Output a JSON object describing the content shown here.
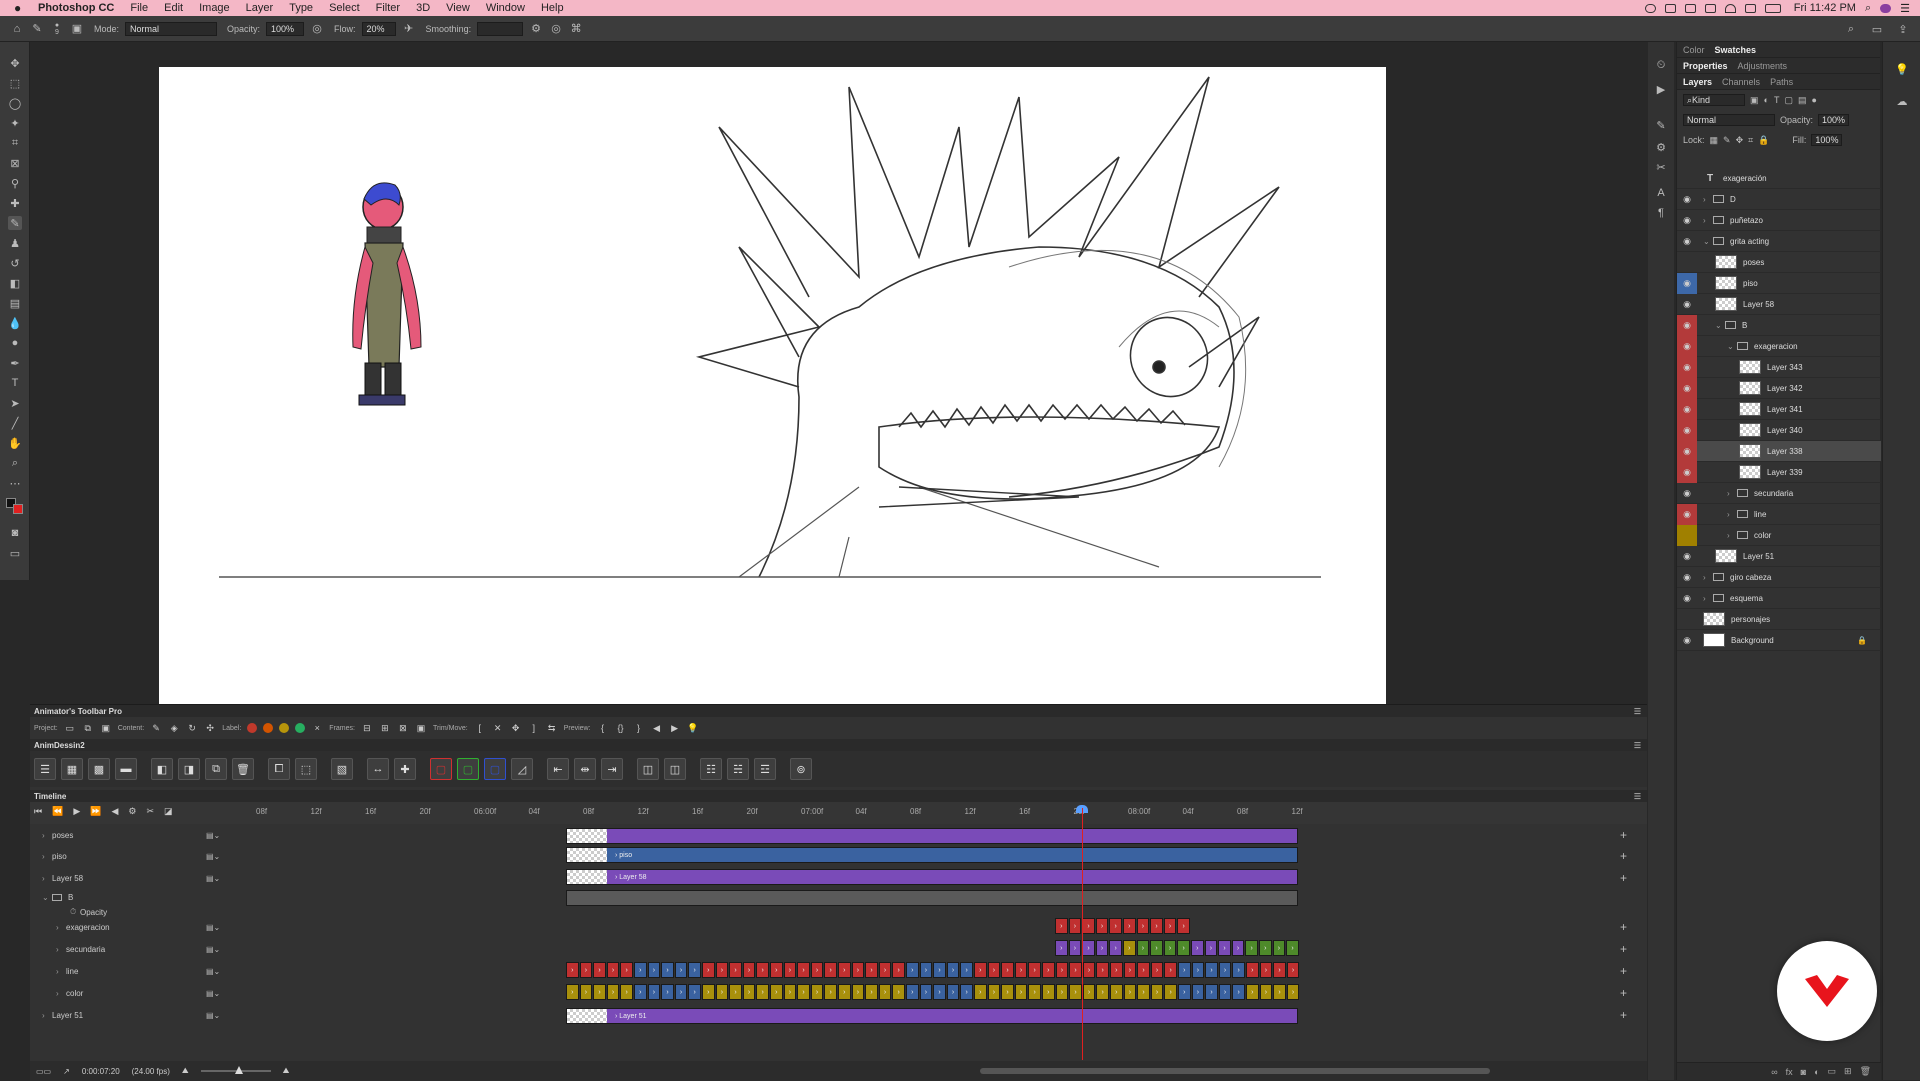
{
  "menubar": {
    "app_name": "Photoshop CC",
    "menus": [
      "File",
      "Edit",
      "Image",
      "Layer",
      "Type",
      "Select",
      "Filter",
      "3D",
      "View",
      "Window",
      "Help"
    ],
    "clock": "Fri 11:42 PM"
  },
  "options_bar": {
    "brush_size": "9",
    "mode_label": "Mode:",
    "mode_value": "Normal",
    "opacity_label": "Opacity:",
    "opacity_value": "100%",
    "flow_label": "Flow:",
    "flow_value": "20%",
    "smoothing_label": "Smoothing:"
  },
  "panels": {
    "top_tabs": [
      "Color",
      "Swatches"
    ],
    "mid_tabs": [
      "Properties",
      "Adjustments"
    ],
    "layer_tabs": [
      "Layers",
      "Channels",
      "Paths"
    ],
    "filter_kind": "Kind",
    "blend_mode": "Normal",
    "opacity_label": "Opacity:",
    "opacity_value": "100%",
    "lock_label": "Lock:",
    "fill_label": "Fill:",
    "fill_value": "100%"
  },
  "layers": [
    {
      "name": "exageración",
      "kind": "text",
      "indent": 0,
      "eye": "",
      "color": ""
    },
    {
      "name": "D",
      "kind": "group",
      "indent": 0,
      "eye": "on",
      "color": ""
    },
    {
      "name": "puñetazo",
      "kind": "group",
      "indent": 0,
      "eye": "on",
      "color": ""
    },
    {
      "name": "grita acting",
      "kind": "group-open",
      "indent": 0,
      "eye": "on",
      "color": ""
    },
    {
      "name": "poses",
      "kind": "pixel",
      "indent": 1,
      "eye": "",
      "color": ""
    },
    {
      "name": "piso",
      "kind": "pixel",
      "indent": 1,
      "eye": "on",
      "color": "#3d68a8"
    },
    {
      "name": "Layer 58",
      "kind": "pixel",
      "indent": 1,
      "eye": "on",
      "color": ""
    },
    {
      "name": "B",
      "kind": "group-open",
      "indent": 1,
      "eye": "on",
      "color": "#b33a3a"
    },
    {
      "name": "exageracion",
      "kind": "group-open",
      "indent": 2,
      "eye": "on",
      "color": "#b33a3a"
    },
    {
      "name": "Layer 343",
      "kind": "pixel",
      "indent": 3,
      "eye": "on",
      "color": "#b33a3a"
    },
    {
      "name": "Layer 342",
      "kind": "pixel",
      "indent": 3,
      "eye": "on",
      "color": "#b33a3a"
    },
    {
      "name": "Layer 341",
      "kind": "pixel",
      "indent": 3,
      "eye": "on",
      "color": "#b33a3a"
    },
    {
      "name": "Layer 340",
      "kind": "pixel",
      "indent": 3,
      "eye": "on",
      "color": "#b33a3a"
    },
    {
      "name": "Layer 338",
      "kind": "pixel",
      "indent": 3,
      "eye": "on",
      "color": "#b33a3a",
      "selected": true
    },
    {
      "name": "Layer 339",
      "kind": "pixel",
      "indent": 3,
      "eye": "on",
      "color": "#b33a3a"
    },
    {
      "name": "secundaria",
      "kind": "group",
      "indent": 2,
      "eye": "on",
      "color": ""
    },
    {
      "name": "line",
      "kind": "group",
      "indent": 2,
      "eye": "on",
      "color": "#b33a3a"
    },
    {
      "name": "color",
      "kind": "group",
      "indent": 2,
      "eye": "",
      "color": "#a08000"
    },
    {
      "name": "Layer 51",
      "kind": "pixel",
      "indent": 1,
      "eye": "on",
      "color": ""
    },
    {
      "name": "giro cabeza",
      "kind": "group",
      "indent": 0,
      "eye": "on",
      "color": ""
    },
    {
      "name": "esquema",
      "kind": "group",
      "indent": 0,
      "eye": "on",
      "color": ""
    },
    {
      "name": "personajes",
      "kind": "pixel",
      "indent": 0,
      "eye": "",
      "color": ""
    },
    {
      "name": "Background",
      "kind": "solid",
      "indent": 0,
      "eye": "on",
      "color": "",
      "locked": true
    }
  ],
  "atp": {
    "title": "Animator's Toolbar Pro",
    "project_label": "Project:",
    "content_label": "Content:",
    "label_label": "Label:",
    "frames_label": "Frames:",
    "trim_label": "Trim/Move:",
    "preview_label": "Preview:",
    "label_colors": [
      "#c0392b",
      "#d35400",
      "#b7950b",
      "#27ae60"
    ]
  },
  "animdessin": {
    "title": "AnimDessin2"
  },
  "timeline": {
    "title": "Timeline",
    "ruler": [
      "08f",
      "12f",
      "16f",
      "20f",
      "06:00f",
      "04f",
      "08f",
      "12f",
      "16f",
      "20f",
      "07:00f",
      "04f",
      "08f",
      "12f",
      "16f",
      "20f",
      "08:00f",
      "04f",
      "08f",
      "12f"
    ],
    "tracks": [
      {
        "name": "poses",
        "indent": 0
      },
      {
        "name": "piso",
        "indent": 0
      },
      {
        "name": "Layer 58",
        "indent": 0
      },
      {
        "name": "B",
        "indent": 0,
        "group": true
      },
      {
        "name": "Opacity",
        "indent": 2,
        "property": true
      },
      {
        "name": "exageracion",
        "indent": 1
      },
      {
        "name": "secundaria",
        "indent": 1
      },
      {
        "name": "line",
        "indent": 1
      },
      {
        "name": "color",
        "indent": 1
      },
      {
        "name": "Layer 51",
        "indent": 0
      }
    ],
    "clips": {
      "piso": "piso",
      "layer58": "Layer 58",
      "layer51": "Layer 51"
    },
    "timecode": "0:00:07:20",
    "fps": "(24.00 fps)"
  },
  "colors": {
    "purple_clip": "#7a4bb8",
    "blue_clip": "#3a62a0",
    "red_clip": "#c03030",
    "yellow_clip": "#a8900c",
    "green_clip": "#4e8a2a",
    "gray_clip": "#5a5a5a",
    "badge_red": "#e8141c"
  }
}
